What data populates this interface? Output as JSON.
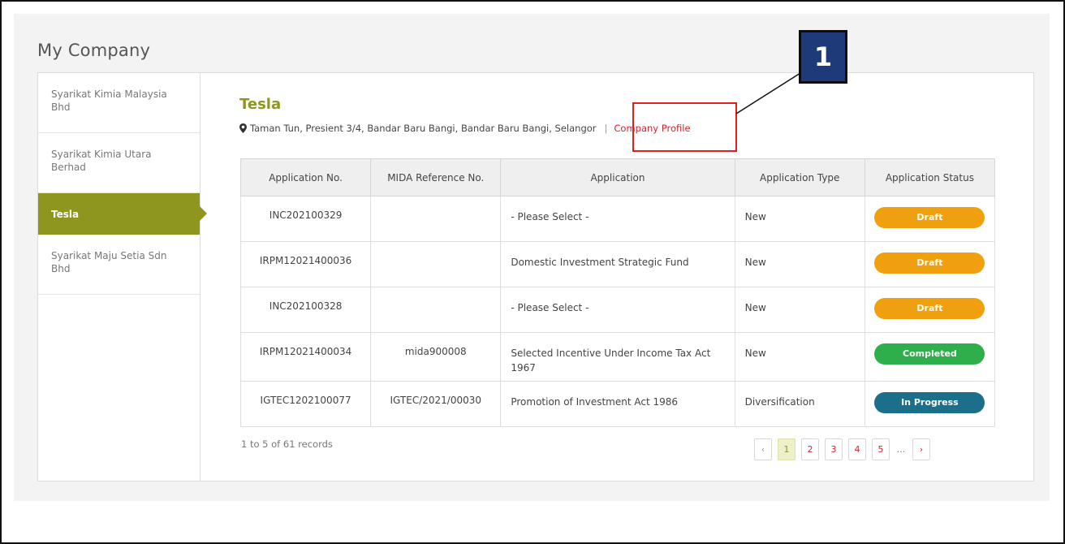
{
  "page": {
    "title": "My Company"
  },
  "sidebar": {
    "items": [
      {
        "label": "Syarikat Kimia Malaysia Bhd",
        "active": false
      },
      {
        "label": "Syarikat Kimia Utara Berhad",
        "active": false
      },
      {
        "label": "Tesla",
        "active": true
      },
      {
        "label": "Syarikat Maju Setia Sdn Bhd",
        "active": false
      }
    ]
  },
  "company": {
    "name": "Tesla",
    "address": "Taman Tun, Presient 3/4, Bandar Baru Bangi, Bandar Baru Bangi, Selangor",
    "separator": "|",
    "profile_link": "Company Profile",
    "location_icon": "map-pin-icon"
  },
  "table": {
    "headers": [
      "Application No.",
      "MIDA Reference No.",
      "Application",
      "Application Type",
      "Application Status"
    ],
    "rows": [
      {
        "app_no": "INC202100329",
        "mida_ref": "",
        "application": "- Please Select -",
        "type": "New",
        "status": "Draft"
      },
      {
        "app_no": "IRPM12021400036",
        "mida_ref": "",
        "application": "Domestic Investment Strategic Fund",
        "type": "New",
        "status": "Draft"
      },
      {
        "app_no": "INC202100328",
        "mida_ref": "",
        "application": "- Please Select -",
        "type": "New",
        "status": "Draft"
      },
      {
        "app_no": "IRPM12021400034",
        "mida_ref": "mida900008",
        "application": "Selected Incentive Under Income Tax Act 1967",
        "type": "New",
        "status": "Completed"
      },
      {
        "app_no": "IGTEC1202100077",
        "mida_ref": "IGTEC/2021/00030",
        "application": "Promotion of Investment Act 1986",
        "type": "Diversification",
        "status": "In Progress"
      }
    ]
  },
  "footer": {
    "records_text": "1 to 5 of 61 records",
    "pagination": {
      "prev": "‹",
      "pages": [
        "1",
        "2",
        "3",
        "4",
        "5"
      ],
      "current": "1",
      "ellipsis": "...",
      "next": "›"
    }
  },
  "annotation": {
    "badge": "1"
  },
  "colors": {
    "brand": "#8f961e",
    "link": "#d9232e",
    "draft": "#f0a00e",
    "completed": "#2fae4c",
    "in_progress": "#1b6f8a",
    "callout": "#1f3a78"
  }
}
